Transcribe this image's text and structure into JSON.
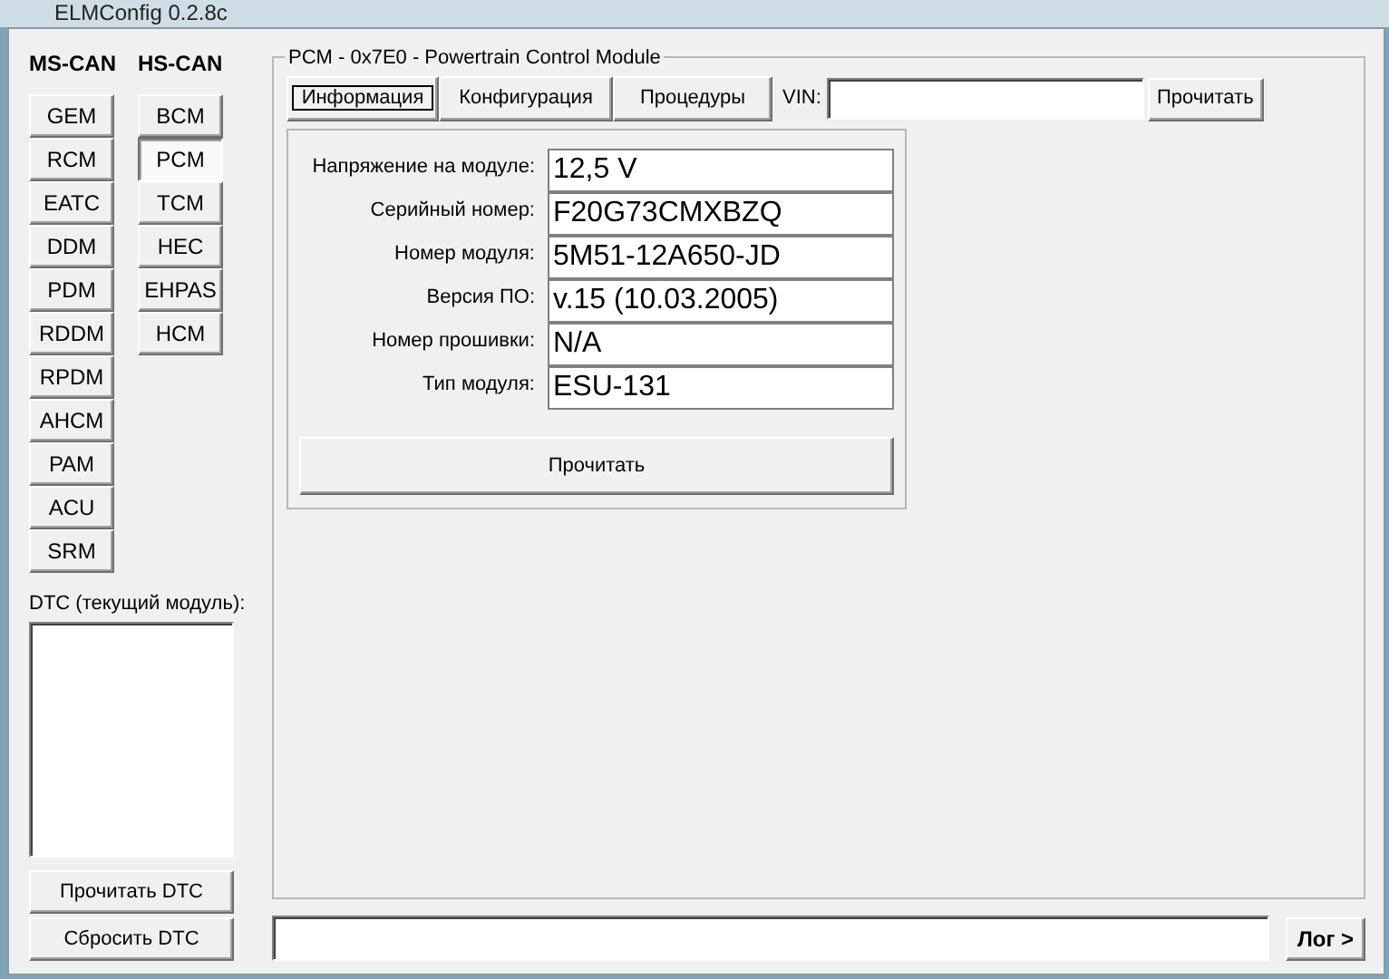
{
  "window": {
    "title": "ELMConfig 0.2.8c"
  },
  "ms_can": {
    "header": "MS-CAN",
    "modules": [
      {
        "label": "GEM",
        "selected": false
      },
      {
        "label": "RCM",
        "selected": false
      },
      {
        "label": "EATC",
        "selected": false
      },
      {
        "label": "DDM",
        "selected": false
      },
      {
        "label": "PDM",
        "selected": false
      },
      {
        "label": "RDDM",
        "selected": false
      },
      {
        "label": "RPDM",
        "selected": false
      },
      {
        "label": "AHCM",
        "selected": false
      },
      {
        "label": "PAM",
        "selected": false
      },
      {
        "label": "ACU",
        "selected": false
      },
      {
        "label": "SRM",
        "selected": false
      }
    ]
  },
  "hs_can": {
    "header": "HS-CAN",
    "modules": [
      {
        "label": "BCM",
        "selected": false
      },
      {
        "label": "PCM",
        "selected": true
      },
      {
        "label": "TCM",
        "selected": false
      },
      {
        "label": "HEC",
        "selected": false
      },
      {
        "label": "EHPAS",
        "selected": false
      },
      {
        "label": "HCM",
        "selected": false
      }
    ]
  },
  "dtc": {
    "label": "DTC (текущий модуль):",
    "buttons": [
      "Прочитать DTC",
      "Сбросить DTC"
    ]
  },
  "module_group": {
    "title": "PCM - 0x7E0 - Powertrain Control Module",
    "tabs": [
      {
        "label": "Информация",
        "selected": true
      },
      {
        "label": "Конфигурация",
        "selected": false
      },
      {
        "label": "Процедуры",
        "selected": false
      }
    ],
    "vin": {
      "label": "VIN:",
      "button": "Прочитать"
    },
    "info": {
      "fields": [
        {
          "label": "Напряжение на модуле:",
          "value": "12,5 V"
        },
        {
          "label": "Серийный номер:",
          "value": "F20G73CMXBZQ"
        },
        {
          "label": "Номер модуля:",
          "value": "5M51-12A650-JD"
        },
        {
          "label": "Версия ПО:",
          "value": "v.15 (10.03.2005)"
        },
        {
          "label": "Номер прошивки:",
          "value": "N/A"
        },
        {
          "label": "Тип модуля:",
          "value": "ESU-131"
        }
      ],
      "read_button": "Прочитать"
    }
  },
  "log_button": "Лог >"
}
